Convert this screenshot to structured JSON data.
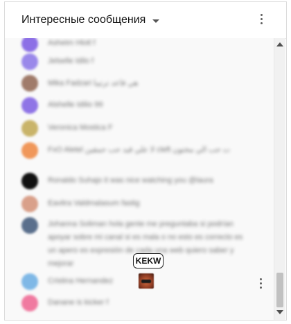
{
  "header": {
    "title": "Интересные сообщения"
  },
  "messages": [
    {
      "author": "Ashetm Hlotl",
      "text": "f",
      "avatar_color": "#8c6fe6"
    },
    {
      "author": "Jelselle Idilo",
      "text": "f",
      "avatar_color": "#9a88ea"
    },
    {
      "author": "Mika Fadzari",
      "text": "هي قاعد ترتيبا",
      "avatar_color": "#a07b6a"
    },
    {
      "author": "Alshelle Idilio",
      "text": "99",
      "avatar_color": "#8f74e6"
    },
    {
      "author": "Veronica Mostica",
      "text": "F",
      "avatar_color": "#c9b46a"
    },
    {
      "author": "FxO Aletel",
      "text": "لا علي قيد حب حمقين cleft ت حب الي مختون",
      "avatar_color": "#f0975a"
    },
    {
      "author": "Ronaldo Suhajo",
      "text": "it was nice watching you @laura",
      "avatar_color": "#111111"
    },
    {
      "author": "Eavitra Valdmalasum",
      "text": "fastig",
      "avatar_color": "#d9a08a"
    },
    {
      "author": "Johanna Soliman",
      "text": "hola gente me preguntaba si podrían apoyar sobre mi canal si es mala o no esto es correcto es un apero es expresión de cada una web quiero saber y mejorar",
      "avatar_color": "#5a6f8c"
    },
    {
      "author": "Cristina Hernandez",
      "text": "",
      "avatar_color": "#7fb8e6"
    },
    {
      "author": "Danane is kicker",
      "text": "f",
      "avatar_color": "#f07aa0"
    }
  ],
  "emote": {
    "name": "KEKW",
    "tooltip": "KEKW"
  },
  "icons": {
    "header_menu": "more-vert-icon",
    "row_menu": "more-vert-icon",
    "dropdown": "caret-down-icon"
  },
  "colors": {
    "background": "#f9f9f9",
    "border": "#dcdcdc"
  }
}
